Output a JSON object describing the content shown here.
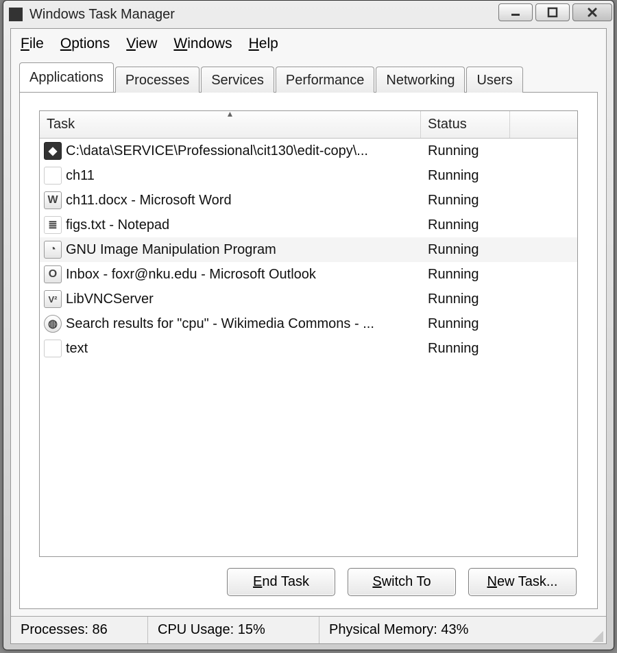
{
  "window": {
    "title": "Windows Task Manager"
  },
  "menus": {
    "file": {
      "label": "File",
      "accel": "F"
    },
    "options": {
      "label": "Options",
      "accel": "O"
    },
    "view": {
      "label": "View",
      "accel": "V"
    },
    "windows": {
      "label": "Windows",
      "accel": "W"
    },
    "help": {
      "label": "Help",
      "accel": "H"
    }
  },
  "tabs": {
    "applications": "Applications",
    "processes": "Processes",
    "services": "Services",
    "performance": "Performance",
    "networking": "Networking",
    "users": "Users",
    "active": "applications"
  },
  "columns": {
    "task": "Task",
    "status": "Status"
  },
  "rows": [
    {
      "icon": "diamond",
      "task": "C:\\data\\SERVICE\\Professional\\cit130\\edit-copy\\...",
      "status": "Running"
    },
    {
      "icon": "folder",
      "task": "ch11",
      "status": "Running"
    },
    {
      "icon": "word",
      "task": "ch11.docx - Microsoft Word",
      "status": "Running"
    },
    {
      "icon": "notepad",
      "task": "figs.txt - Notepad",
      "status": "Running"
    },
    {
      "icon": "gimp",
      "task": "GNU Image Manipulation Program",
      "status": "Running",
      "selected": true
    },
    {
      "icon": "outlook",
      "task": "Inbox - foxr@nku.edu - Microsoft Outlook",
      "status": "Running"
    },
    {
      "icon": "vnc",
      "task": "LibVNCServer",
      "status": "Running"
    },
    {
      "icon": "browser",
      "task": "Search results for \"cpu\" - Wikimedia Commons - ...",
      "status": "Running"
    },
    {
      "icon": "folder",
      "task": "text",
      "status": "Running"
    }
  ],
  "buttons": {
    "end_task": {
      "label": "End Task",
      "accel": "E"
    },
    "switch_to": {
      "label": "Switch To",
      "accel": "S"
    },
    "new_task": {
      "label": "New Task...",
      "accel": "N"
    }
  },
  "statusbar": {
    "processes": "Processes: 86",
    "cpu": "CPU Usage: 15%",
    "memory": "Physical Memory: 43%"
  }
}
